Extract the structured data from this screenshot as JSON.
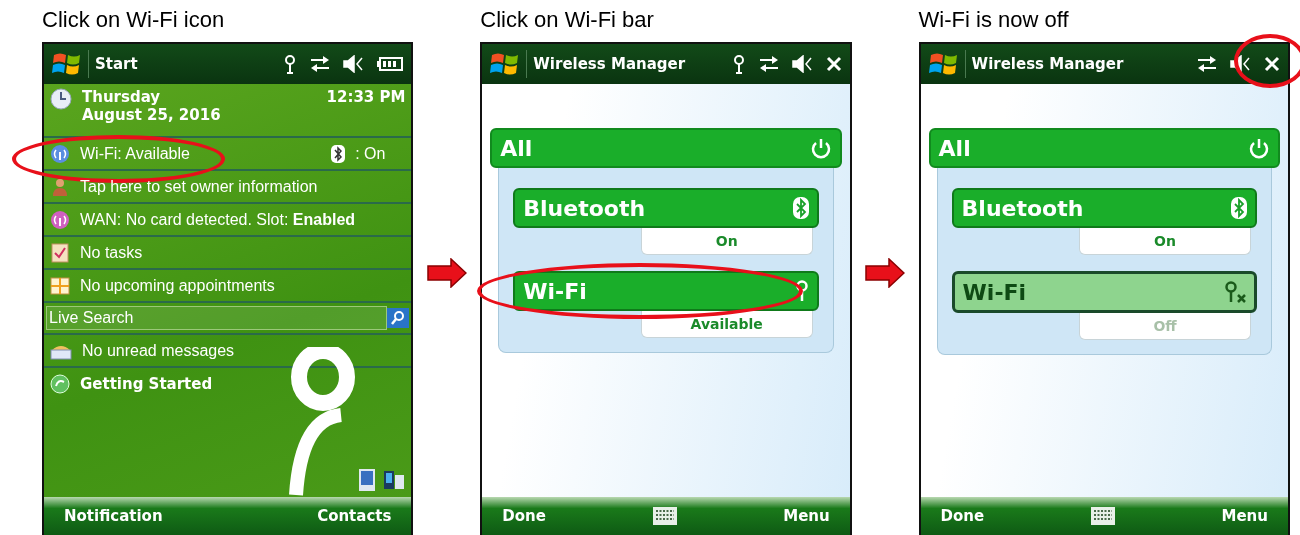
{
  "steps": [
    {
      "caption": "Click on Wi-Fi icon",
      "screen": {
        "kind": "today",
        "title": "Start",
        "status_icons": [
          {
            "kind": "antenna"
          },
          {
            "kind": "sync"
          },
          {
            "kind": "speaker"
          },
          {
            "kind": "battery"
          }
        ],
        "rows": [
          {
            "kind": "date",
            "day": "Thursday",
            "date": "August 25, 2016",
            "time": "12:33 PM"
          },
          {
            "kind": "wireless",
            "text": "Wi-Fi: Available",
            "bluetooth": ": On",
            "highlighted": true
          },
          {
            "kind": "owner",
            "text": "Tap here to set owner information"
          },
          {
            "kind": "wan",
            "text": "WAN: No card detected.  Slot: **Enabled**"
          },
          {
            "kind": "tasks",
            "text": "No tasks"
          },
          {
            "kind": "calendar",
            "text": "No upcoming appointments"
          },
          {
            "kind": "search",
            "placeholder": "Live Search"
          },
          {
            "kind": "mail",
            "text": "No unread messages"
          },
          {
            "kind": "start",
            "text": "Getting Started"
          }
        ],
        "softkeys": [
          "Notification",
          "Contacts"
        ]
      }
    },
    {
      "caption": "Click on Wi-Fi bar",
      "screen": {
        "kind": "wireless",
        "title": "Wireless Manager",
        "status_icons": [
          {
            "kind": "antenna"
          },
          {
            "kind": "sync"
          },
          {
            "kind": "speaker"
          },
          {
            "kind": "close",
            "highlighted": false
          }
        ],
        "all_label": "All",
        "devices": [
          {
            "kind": "bluetooth",
            "name": "Bluetooth",
            "status": "On",
            "on": true,
            "highlighted": false
          },
          {
            "kind": "wifi",
            "name": "Wi-Fi",
            "status": "Available",
            "on": true,
            "highlighted": true
          }
        ],
        "softkeys": [
          "Done",
          "Menu"
        ]
      }
    },
    {
      "caption": "Wi-Fi is now off",
      "screen": {
        "kind": "wireless",
        "title": "Wireless Manager",
        "status_icons": [
          {
            "kind": "sync"
          },
          {
            "kind": "speaker"
          },
          {
            "kind": "close",
            "highlighted": true
          }
        ],
        "all_label": "All",
        "devices": [
          {
            "kind": "bluetooth",
            "name": "Bluetooth",
            "status": "On",
            "on": true,
            "highlighted": false
          },
          {
            "kind": "wifi",
            "name": "Wi-Fi",
            "status": "Off",
            "on": false,
            "highlighted": false
          }
        ],
        "softkeys": [
          "Done",
          "Menu"
        ]
      }
    }
  ]
}
